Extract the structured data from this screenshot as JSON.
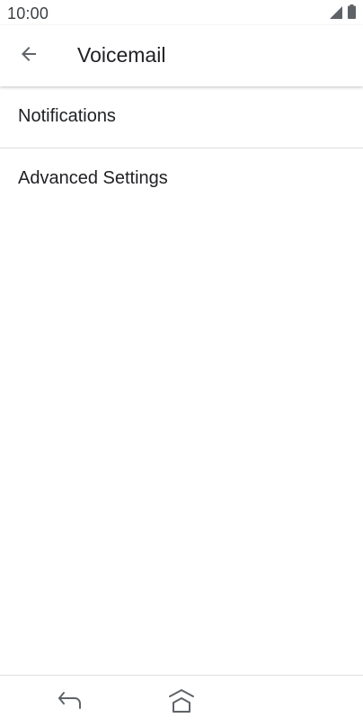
{
  "status_bar": {
    "time": "10:00",
    "icons": [
      "signal-icon",
      "battery-icon"
    ]
  },
  "app_bar": {
    "back_icon": "arrow-back-icon",
    "title": "Voicemail"
  },
  "settings": {
    "items": [
      {
        "label": "Notifications"
      },
      {
        "label": "Advanced Settings"
      }
    ]
  },
  "nav_bar": {
    "icons": [
      "nav-back-icon",
      "nav-home-icon"
    ]
  },
  "colors": {
    "text_primary": "#202124",
    "icon": "#5f6368",
    "divider": "#dadce0",
    "background": "#ffffff"
  }
}
